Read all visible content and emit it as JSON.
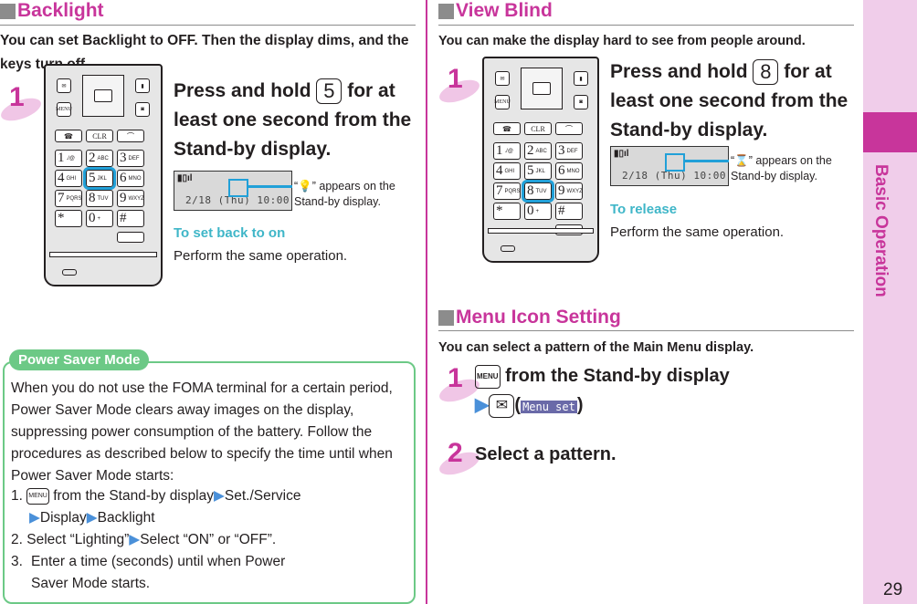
{
  "sidebar": {
    "label": "Basic Operation",
    "page_number": "29",
    "accent_color": "#c8359b"
  },
  "backlight": {
    "title": "Backlight",
    "lead": "You can set Backlight to OFF. Then the display dims, and the keys turn off.",
    "step1": {
      "number": "1",
      "text_before": "Press and hold",
      "key": "5",
      "text_after": "for at least one second from the Stand-by display.",
      "lcd_date": "2/18 (Thu) 10:00",
      "caption": "“” appears on the Stand-by display.",
      "caption_pre": "“",
      "caption_post": "” appears on the Stand-by display.",
      "sub_heading": "To set back to on",
      "sub_text": "Perform the same operation."
    }
  },
  "power_saver": {
    "tab_label": "Power Saver Mode",
    "intro": "When you do not use the FOMA terminal for a certain period, Power Saver Mode clears away images on the display, suppressing power consumption of the battery. Follow the procedures as described below to specify the time until when Power Saver Mode starts:",
    "steps": [
      {
        "num": "1.",
        "key": "MENU",
        "text": "from the Stand-by display",
        "path": [
          "Set./Service",
          "Display",
          "Backlight"
        ]
      },
      {
        "num": "2.",
        "text": "Select “Lighting”",
        "path": [
          "Select “ON” or “OFF”."
        ]
      },
      {
        "num": "3.",
        "text": "Enter a time (seconds) until when Power Saver Mode starts."
      }
    ]
  },
  "view_blind": {
    "title": "View Blind",
    "lead": "You can make the display hard to see from people around.",
    "step1": {
      "number": "1",
      "text_before": "Press and hold",
      "key": "8",
      "text_after": "for at least one second from the Stand-by display.",
      "lcd_date": "2/18 (Thu) 10:00",
      "caption_pre": "“",
      "caption_post": "” appears on the Stand-by display.",
      "sub_heading": "To release",
      "sub_text": "Perform the same operation."
    }
  },
  "menu_icon": {
    "title": "Menu Icon Setting",
    "lead": "You can select a pattern of the Main Menu display.",
    "step1": {
      "number": "1",
      "key": "MENU",
      "text": "from the Stand-by display",
      "mail_key": "✉",
      "softkey_label": "Menu set"
    },
    "step2": {
      "number": "2",
      "text": "Select a pattern."
    }
  },
  "phone_keys": [
    {
      "main": "1",
      "sub": "./@"
    },
    {
      "main": "2",
      "sub": "ABC"
    },
    {
      "main": "3",
      "sub": "DEF"
    },
    {
      "main": "4",
      "sub": "GHI"
    },
    {
      "main": "5",
      "sub": "JKL"
    },
    {
      "main": "6",
      "sub": "MNO"
    },
    {
      "main": "7",
      "sub": "PQRS"
    },
    {
      "main": "8",
      "sub": "TUV"
    },
    {
      "main": "9",
      "sub": "WXYZ"
    },
    {
      "main": "*",
      "sub": ""
    },
    {
      "main": "0",
      "sub": "+"
    },
    {
      "main": "#",
      "sub": ""
    }
  ]
}
